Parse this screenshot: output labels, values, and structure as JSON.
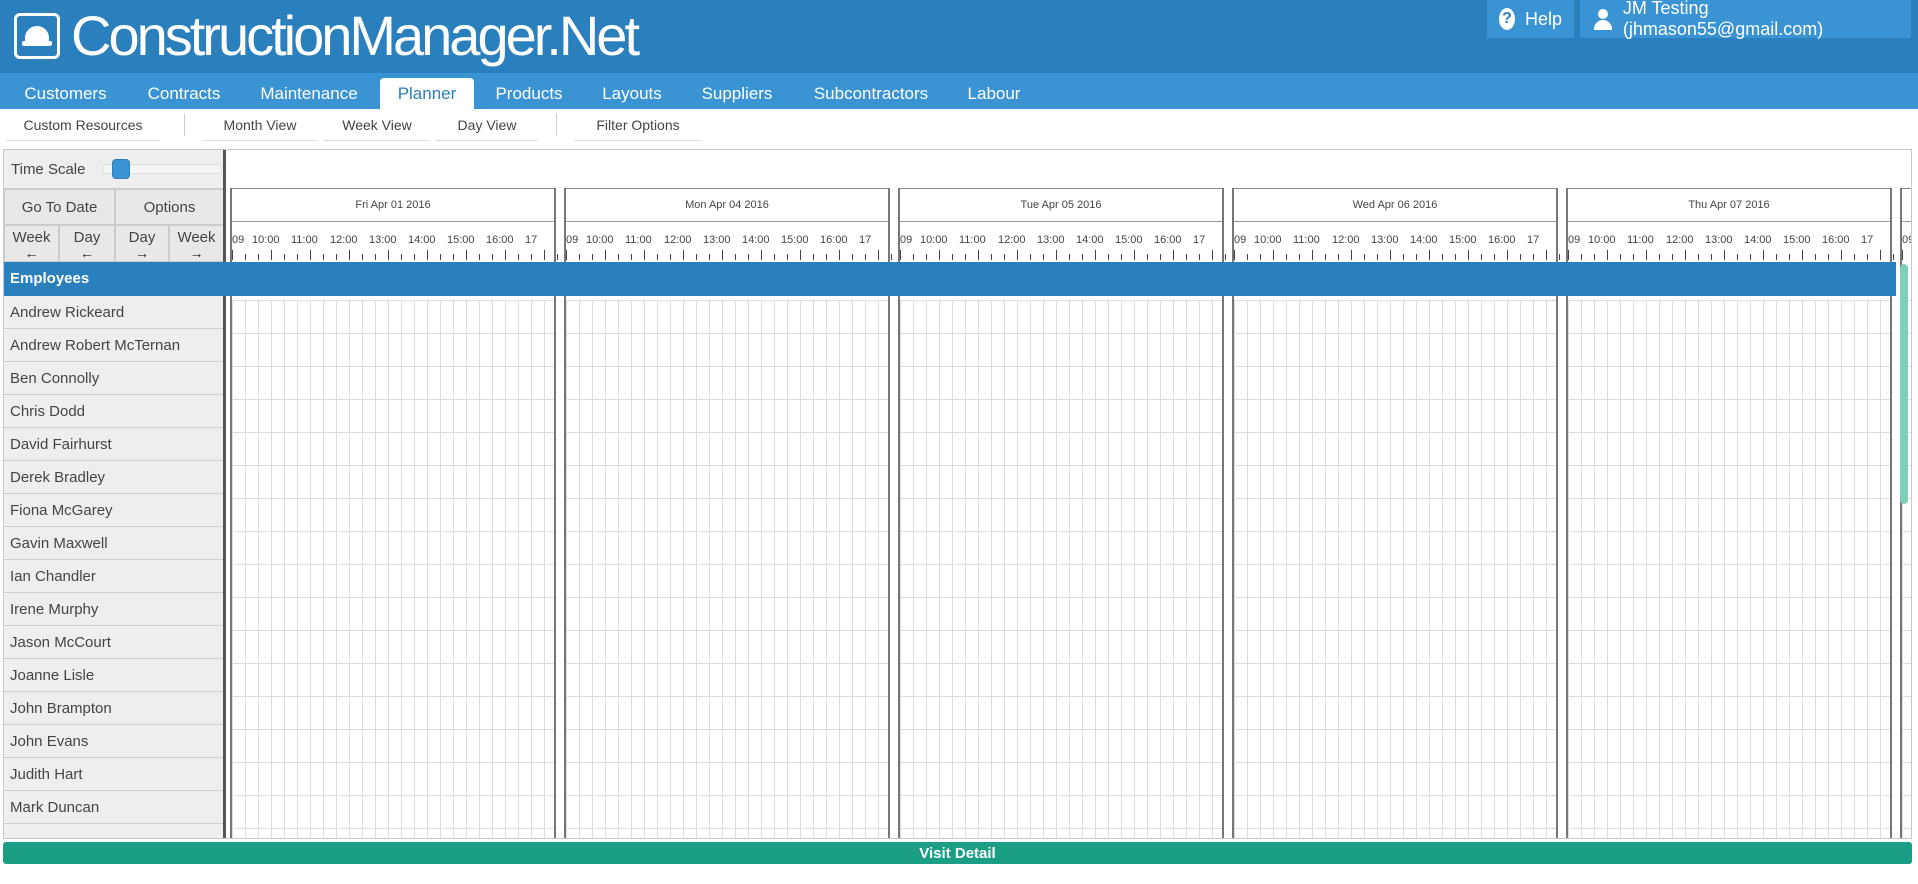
{
  "app": {
    "title": "ConstructionManager.Net"
  },
  "header": {
    "help_label": "Help",
    "user_label": "JM Testing (jhmason55@gmail.com)"
  },
  "main_nav": {
    "items": [
      {
        "label": "Customers"
      },
      {
        "label": "Contracts"
      },
      {
        "label": "Maintenance"
      },
      {
        "label": "Planner",
        "active": true
      },
      {
        "label": "Products"
      },
      {
        "label": "Layouts"
      },
      {
        "label": "Suppliers"
      },
      {
        "label": "Subcontractors"
      },
      {
        "label": "Labour"
      }
    ]
  },
  "sub_nav": {
    "items": [
      {
        "label": "Custom Resources"
      },
      {
        "label": "Month View"
      },
      {
        "label": "Week View"
      },
      {
        "label": "Day View"
      },
      {
        "label": "Filter Options"
      }
    ]
  },
  "controls": {
    "time_scale_label": "Time Scale",
    "time_scale_value": 0.1,
    "go_to_date": "Go To Date",
    "options": "Options",
    "week_back": "Week",
    "day_back": "Day",
    "day_forward": "Day",
    "week_forward": "Week",
    "arrow_left": "←",
    "arrow_right": "→"
  },
  "timeline": {
    "days": [
      "Fri Apr 01 2016",
      "Mon Apr 04 2016",
      "Tue Apr 05 2016",
      "Wed Apr 06 2016",
      "Thu Apr 07 2016",
      ""
    ],
    "hours": [
      "09",
      "10:00",
      "11:00",
      "12:00",
      "13:00",
      "14:00",
      "15:00",
      "16:00",
      "17"
    ]
  },
  "resources": {
    "group_label": "Employees",
    "employees": [
      "Andrew Rickeard",
      "Andrew Robert McTernan",
      "Ben Connolly",
      "Chris Dodd",
      "David Fairhurst",
      "Derek Bradley",
      "Fiona McGarey",
      "Gavin Maxwell",
      "Ian Chandler",
      "Irene Murphy",
      "Jason McCourt",
      "Joanne Lisle",
      "John Brampton",
      "John Evans",
      "Judith Hart",
      "Mark Duncan"
    ]
  },
  "footer": {
    "visit_detail": "Visit Detail"
  },
  "colors": {
    "header_blue": "#2a7fbd",
    "nav_blue": "#3a94d4",
    "footer_green": "#1a9e84"
  }
}
